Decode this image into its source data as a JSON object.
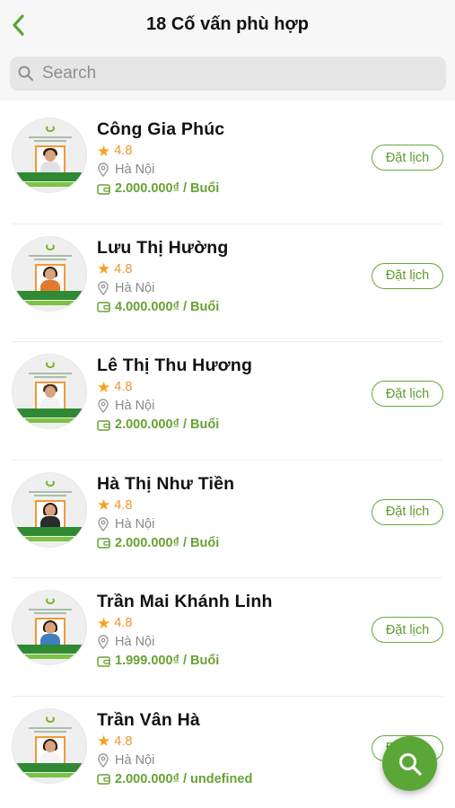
{
  "header": {
    "title": "18 Cố vấn phù hợp",
    "back_icon": "chevron-left-icon"
  },
  "search": {
    "placeholder": "Search",
    "value": "",
    "icon": "search-icon"
  },
  "colors": {
    "accent": "#5aa738",
    "rating": "#f5a21e",
    "price": "#68a234",
    "location": "#888888"
  },
  "advisors": [
    {
      "name": "Công Gia Phúc",
      "rating": "4.8",
      "location": "Hà Nội",
      "price": "2.000.000₫ / Buổi",
      "book_label": "Đặt lịch"
    },
    {
      "name": "Lưu Thị Hường",
      "rating": "4.8",
      "location": "Hà Nội",
      "price": "4.000.000₫ / Buổi",
      "book_label": "Đặt lịch"
    },
    {
      "name": "Lê Thị Thu Hương",
      "rating": "4.8",
      "location": "Hà Nội",
      "price": "2.000.000₫ / Buổi",
      "book_label": "Đặt lịch"
    },
    {
      "name": "Hà Thị Như Tiền",
      "rating": "4.8",
      "location": "Hà Nội",
      "price": "2.000.000₫ / Buổi",
      "book_label": "Đặt lịch"
    },
    {
      "name": "Trần Mai Khánh Linh",
      "rating": "4.8",
      "location": "Hà Nội",
      "price": "1.999.000₫ / Buổi",
      "book_label": "Đặt lịch"
    },
    {
      "name": "Trần Vân Hà",
      "rating": "4.8",
      "location": "Hà Nội",
      "price": "2.000.000₫ / undefined",
      "book_label": "Đặt lịch"
    }
  ],
  "fab": {
    "icon": "search-icon"
  }
}
